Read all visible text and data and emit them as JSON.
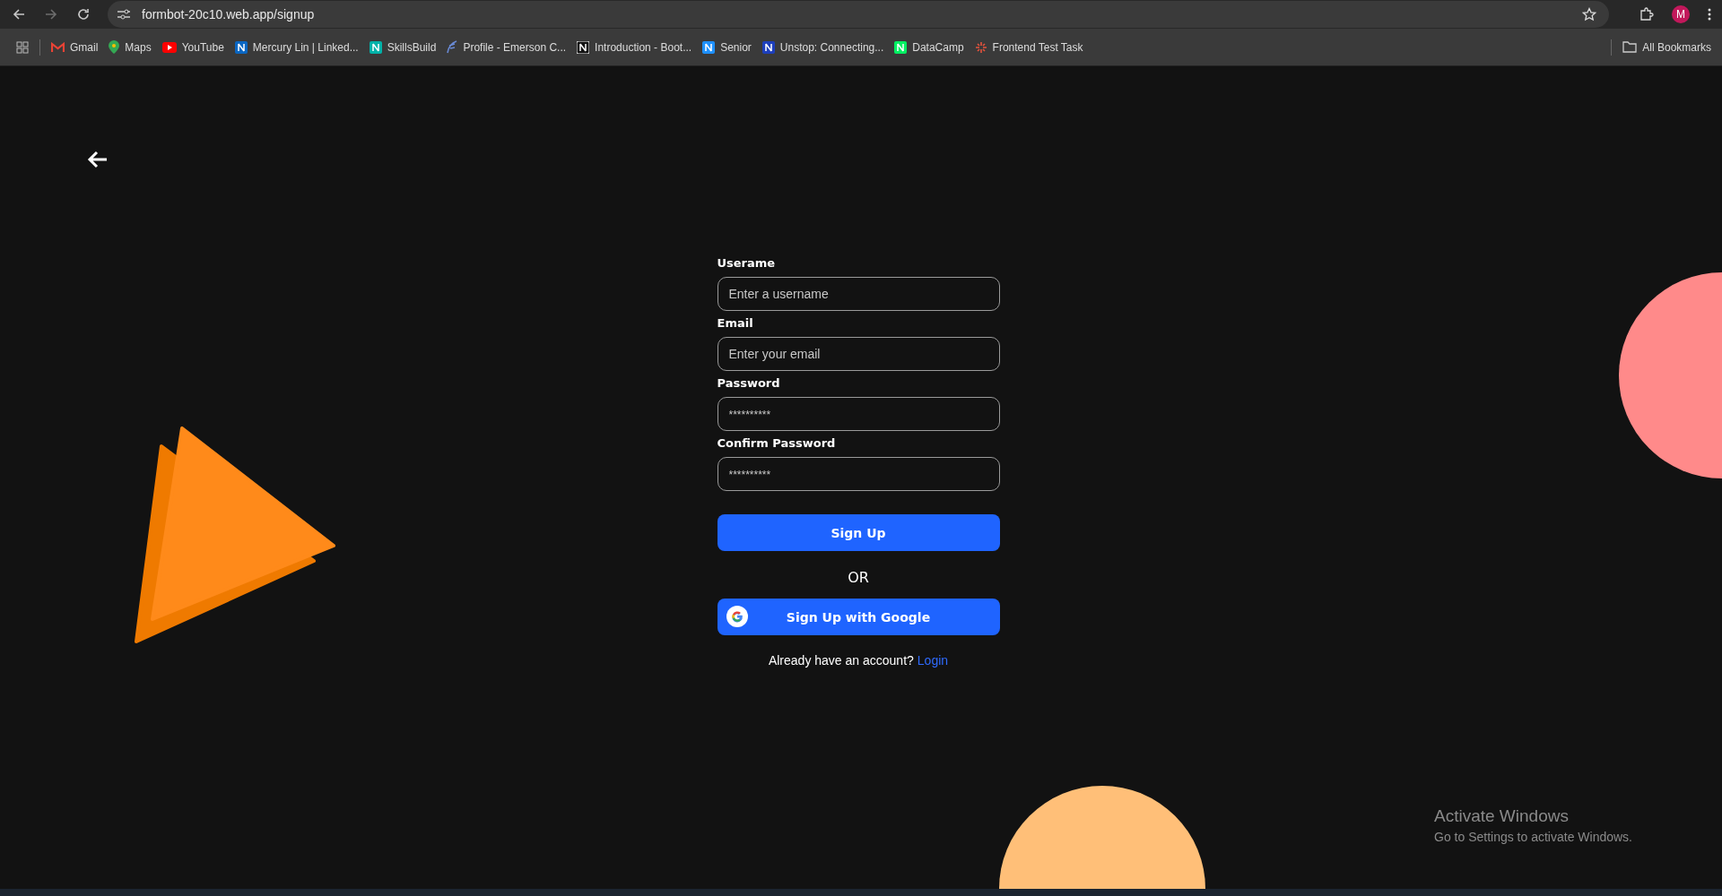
{
  "browser": {
    "url": "formbot-20c10.web.app/signup",
    "profile_initial": "M",
    "bookmarks": [
      {
        "label": "Gmail",
        "kind": "gmail"
      },
      {
        "label": "Maps",
        "kind": "maps"
      },
      {
        "label": "YouTube",
        "kind": "youtube"
      },
      {
        "label": "Mercury Lin | Linked...",
        "kind": "in"
      },
      {
        "label": "SkillsBuild",
        "kind": "yl"
      },
      {
        "label": "Profile - Emerson C...",
        "kind": "feather"
      },
      {
        "label": "Introduction - Boot...",
        "kind": "notion"
      },
      {
        "label": "Senior",
        "kind": "s"
      },
      {
        "label": "Unstop: Connecting...",
        "kind": "un"
      },
      {
        "label": "DataCamp",
        "kind": "dc"
      },
      {
        "label": "Frontend Test Task",
        "kind": "burst"
      }
    ],
    "all_bookmarks": "All Bookmarks"
  },
  "form": {
    "fields": [
      {
        "label": "Userame",
        "placeholder": "Enter a username"
      },
      {
        "label": "Email",
        "placeholder": "Enter your email"
      },
      {
        "label": "Password",
        "placeholder": "**********"
      },
      {
        "label": "Confirm Password",
        "placeholder": "**********"
      }
    ],
    "submit": "Sign Up",
    "divider": "OR",
    "google_button": "Sign Up with Google",
    "footer_text": "Already have an account?",
    "footer_link": "Login"
  },
  "windows_notice": {
    "title": "Activate Windows",
    "subtitle": "Go to Settings to activate Windows."
  }
}
